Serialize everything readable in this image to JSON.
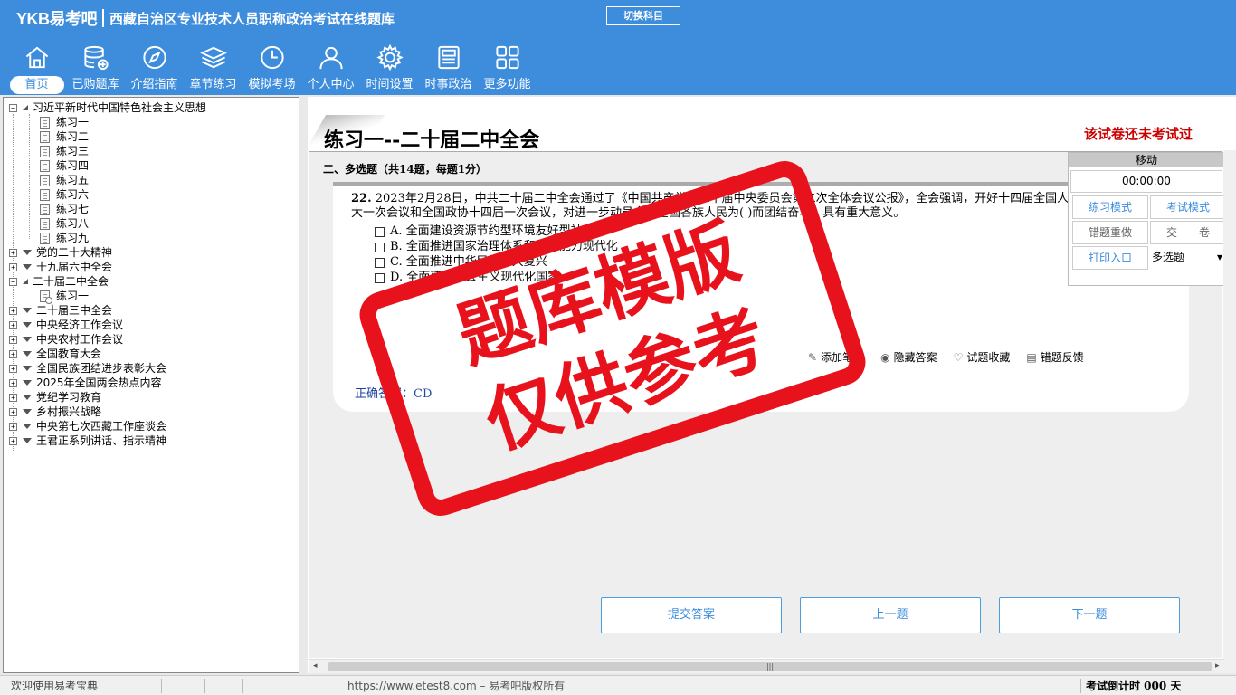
{
  "header": {
    "logo": "YKB易考吧",
    "site_title": "西藏自治区专业技术人员职称政治考试在线题库",
    "switch_subject": "切换科目"
  },
  "nav": [
    {
      "label": "首页",
      "icon": "home-icon"
    },
    {
      "label": "已购题库",
      "icon": "database-icon"
    },
    {
      "label": "介绍指南",
      "icon": "compass-icon"
    },
    {
      "label": "章节练习",
      "icon": "layers-icon"
    },
    {
      "label": "模拟考场",
      "icon": "clock-icon"
    },
    {
      "label": "个人中心",
      "icon": "user-icon"
    },
    {
      "label": "时间设置",
      "icon": "gear-icon"
    },
    {
      "label": "时事政治",
      "icon": "newspaper-icon"
    },
    {
      "label": "更多功能",
      "icon": "grid-icon"
    }
  ],
  "tree": {
    "root": "习近平新时代中国特色社会主义思想",
    "exercises": [
      "练习一",
      "练习二",
      "练习三",
      "练习四",
      "练习五",
      "练习六",
      "练习七",
      "练习八",
      "练习九"
    ],
    "g1": "党的二十大精神",
    "g2": "十九届六中全会",
    "g3": "二十届二中全会",
    "g3_child": "练习一",
    "rest": [
      "二十届三中全会",
      "中央经济工作会议",
      "中央农村工作会议",
      "全国教育大会",
      "全国民族团结进步表彰大会",
      "2025年全国两会热点内容",
      "党纪学习教育",
      "乡村振兴战略",
      "中央第七次西藏工作座谈会",
      "王君正系列讲话、指示精神"
    ]
  },
  "main": {
    "page_title": "练习一--二十届二中全会",
    "not_taken": "该试卷还未考试过",
    "section_head": "二、多选题（共14题，每题1分）",
    "question": {
      "number": "22.",
      "text": "2023年2月28日，中共二十届二中全会通过了《中国共产党第二十届中央委员会第二次全体会议公报》，全会强调，开好十四届全国人大一次会议和全国政协十四届一次会议，对进一步动员全党全国各族人民为( )而团结奋斗，具有重大意义。",
      "options": [
        "A. 全面建设资源节约型环境友好型社会",
        "B. 全面推进国家治理体系和治理能力现代化",
        "C. 全面推进中华民族伟大复兴",
        "D. 全面建设社会主义现代化国家"
      ],
      "answer": "正确答案：CD"
    },
    "tools": [
      "添加笔记",
      "隐藏答案",
      "试题收藏",
      "错题反馈"
    ],
    "buttons": {
      "submit": "提交答案",
      "prev": "上一题",
      "next": "下一题"
    }
  },
  "float_panel": {
    "move": "移动",
    "timer": "00:00:00",
    "practice": "练习模式",
    "exam": "考试模式",
    "redo": "错题重做",
    "hand_in": "交　　卷",
    "print": "打印入口",
    "type_select": "多选题"
  },
  "status": {
    "welcome": "欢迎使用易考宝典",
    "copyright": "https://www.etest8.com – 易考吧版权所有",
    "countdown": "考试倒计时 000 天"
  },
  "watermark": {
    "line1": "题库模版",
    "line2": "仅供参考"
  }
}
